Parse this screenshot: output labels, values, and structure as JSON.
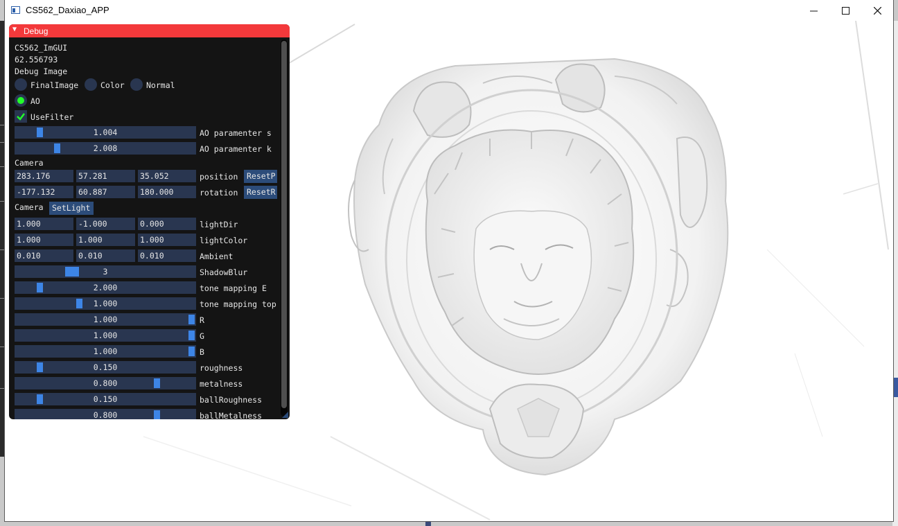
{
  "window": {
    "title": "CS562_Daxiao_APP"
  },
  "panel": {
    "title": "Debug",
    "heading": "CS562_ImGUI",
    "fps": "62.556793",
    "debug_image_label": "Debug Image",
    "radios": [
      {
        "label": "FinalImage",
        "selected": false
      },
      {
        "label": "Color",
        "selected": false
      },
      {
        "label": "Normal",
        "selected": false
      },
      {
        "label": "AO",
        "selected": true
      }
    ],
    "use_filter": {
      "label": "UseFilter",
      "checked": true
    },
    "ao_s": {
      "value": "1.004",
      "label": "AO paramenter s",
      "fraction": 0.12
    },
    "ao_k": {
      "value": "2.008",
      "label": "AO paramenter k",
      "fraction": 0.22
    },
    "camera_label": "Camera",
    "position": {
      "x": "283.176",
      "y": "57.281",
      "z": "35.052",
      "label": "position",
      "reset": "ResetP"
    },
    "rotation": {
      "x": "-177.132",
      "y": "60.887",
      "z": "180.000",
      "label": "rotation",
      "reset": "ResetR"
    },
    "camera_label2": "Camera",
    "set_light": "SetLight",
    "light_dir": {
      "x": "1.000",
      "y": "-1.000",
      "z": "0.000",
      "label": "lightDir"
    },
    "light_color": {
      "x": "1.000",
      "y": "1.000",
      "z": "1.000",
      "label": "lightColor"
    },
    "ambient": {
      "x": "0.010",
      "y": "0.010",
      "z": "0.010",
      "label": "Ambient"
    },
    "shadow_blur": {
      "value": "3",
      "label": "ShadowBlur",
      "fraction": 0.3
    },
    "tone_e": {
      "value": "2.000",
      "label": "tone mapping E",
      "fraction": 0.12
    },
    "tone_top": {
      "value": "1.000",
      "label": "tone mapping top",
      "fraction": 0.35
    },
    "r": {
      "value": "1.000",
      "label": "R",
      "fraction": 1.0
    },
    "g": {
      "value": "1.000",
      "label": "G",
      "fraction": 1.0
    },
    "b": {
      "value": "1.000",
      "label": "B",
      "fraction": 1.0
    },
    "roughness": {
      "value": "0.150",
      "label": "roughness",
      "fraction": 0.12
    },
    "metalness": {
      "value": "0.800",
      "label": "metalness",
      "fraction": 0.8
    },
    "ball_roughness": {
      "value": "0.150",
      "label": "ballRoughness",
      "fraction": 0.12
    },
    "ball_metalness": {
      "value": "0.800",
      "label": "ballMetalness",
      "fraction": 0.8
    }
  },
  "colors": {
    "title_bar": "#f3393b",
    "panel_bg": "#141414",
    "widget_bg": "#293650",
    "grab": "#3d85e6",
    "radio_on": "#23ff2b"
  }
}
